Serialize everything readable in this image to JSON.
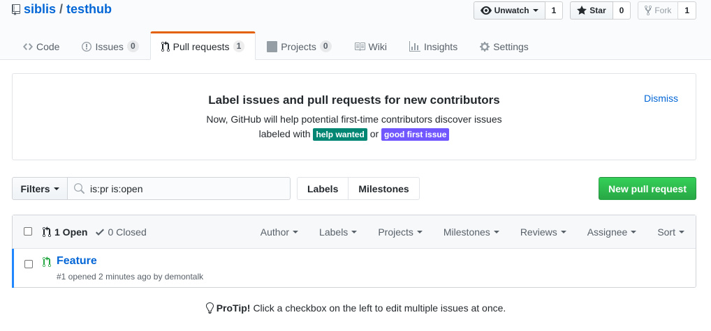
{
  "repo": {
    "owner": "siblis",
    "separator": "/",
    "name": "testhub"
  },
  "actions": {
    "watch": {
      "label": "Unwatch",
      "count": "1"
    },
    "star": {
      "label": "Star",
      "count": "0"
    },
    "fork": {
      "label": "Fork",
      "count": "1"
    }
  },
  "nav": {
    "code": {
      "label": "Code",
      "icon": "code-icon"
    },
    "issues": {
      "label": "Issues",
      "count": "0",
      "icon": "issue-opened-icon"
    },
    "pulls": {
      "label": "Pull requests",
      "count": "1",
      "icon": "git-pull-request-icon",
      "selected": true
    },
    "projects": {
      "label": "Projects",
      "count": "0",
      "icon": "project-icon"
    },
    "wiki": {
      "label": "Wiki",
      "icon": "book-icon"
    },
    "insights": {
      "label": "Insights",
      "icon": "graph-icon"
    },
    "settings": {
      "label": "Settings",
      "icon": "gear-icon"
    }
  },
  "banner": {
    "title": "Label issues and pull requests for new contributors",
    "line1": "Now, GitHub will help potential first-time contributors discover issues",
    "line2_prefix": "labeled with",
    "label1": "help wanted",
    "connector": "or",
    "label2": "good first issue",
    "dismiss": "Dismiss",
    "label1_color": "#008672",
    "label2_color": "#7057ff"
  },
  "subnav": {
    "filters": "Filters",
    "search_value": "is:pr is:open",
    "labels": "Labels",
    "milestones": "Milestones",
    "new_pr": "New pull request"
  },
  "list": {
    "open": "1 Open",
    "closed": "0 Closed",
    "toolbar": [
      "Author",
      "Labels",
      "Projects",
      "Milestones",
      "Reviews",
      "Assignee",
      "Sort"
    ],
    "items": [
      {
        "title": "Feature",
        "meta": "#1 opened 2 minutes ago by demontalk"
      }
    ]
  },
  "protip": {
    "label": "ProTip!",
    "text": "Click a checkbox on the left to edit multiple issues at once."
  },
  "colors": {
    "accent": "#0366d6",
    "tab_highlight": "#e36209",
    "success": "#28a745",
    "selected_row": "#2188ff"
  }
}
